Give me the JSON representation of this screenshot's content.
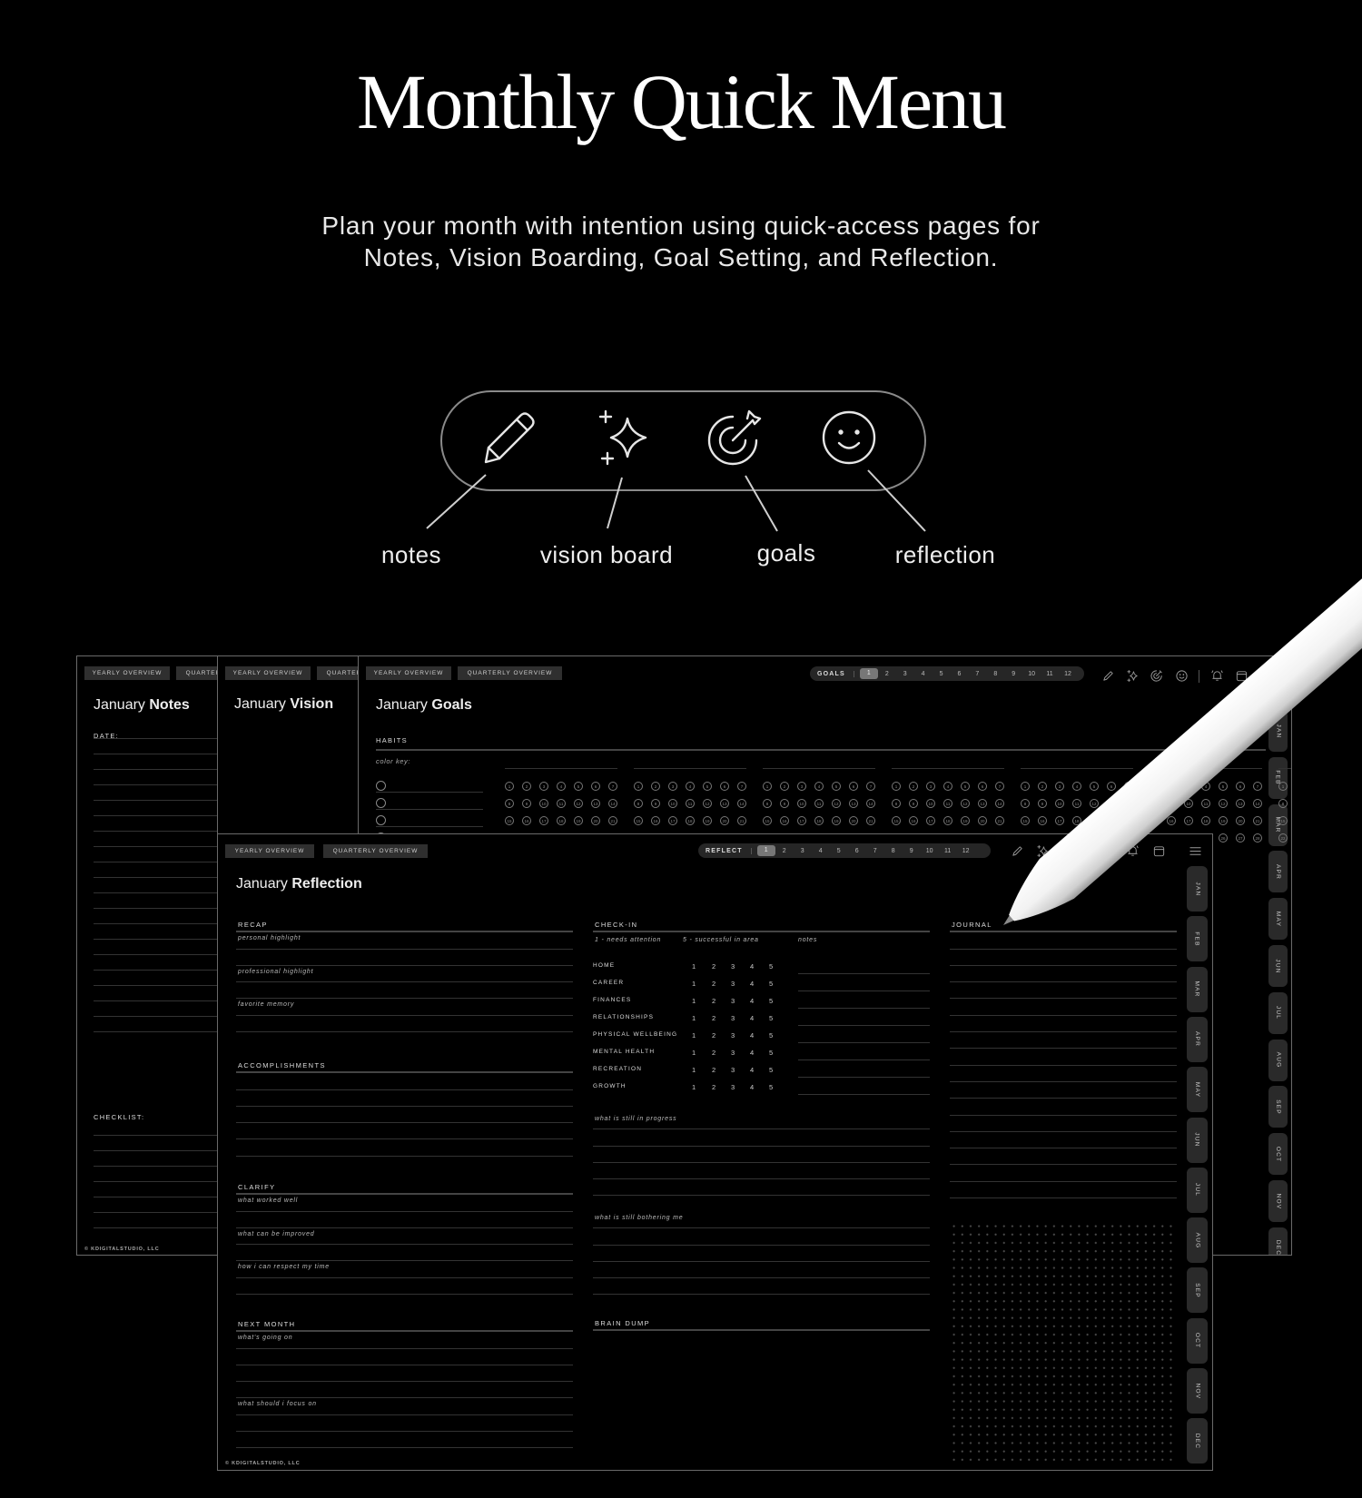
{
  "header": {
    "title": "Monthly Quick Menu",
    "subtitle_line1": "Plan your month with intention using quick-access pages for",
    "subtitle_line2": "Notes, Vision Boarding, Goal Setting, and Reflection."
  },
  "quick_menu": {
    "items": [
      {
        "icon": "pencil-icon",
        "label": "notes"
      },
      {
        "icon": "sparkle-icon",
        "label": "vision board"
      },
      {
        "icon": "target-icon",
        "label": "goals"
      },
      {
        "icon": "smiley-icon",
        "label": "reflection"
      }
    ]
  },
  "common": {
    "yearly_overview": "YEARLY OVERVIEW",
    "quarterly_overview": "QUARTERLY OVERVIEW",
    "footer": "© KDIGITALSTUDIO, LLC",
    "months": [
      "JAN",
      "FEB",
      "MAR",
      "APR",
      "MAY",
      "JUN",
      "JUL",
      "AUG",
      "SEP",
      "OCT",
      "NOV",
      "DEC"
    ],
    "month_numbers": [
      "1",
      "2",
      "3",
      "4",
      "5",
      "6",
      "7",
      "8",
      "9",
      "10",
      "11",
      "12"
    ],
    "active_month": "1",
    "toolbar_icons": [
      "pencil-icon",
      "sparkle-icon",
      "target-icon",
      "smiley-icon",
      "bell-icon",
      "calendar-icon",
      "menu-icon"
    ]
  },
  "notes_page": {
    "title_light": "January",
    "title_bold": "Notes",
    "date_label": "DATE:",
    "checklist_label": "CHECKLIST:"
  },
  "vision_page": {
    "title_light": "January",
    "title_bold": "Vision"
  },
  "goals_page": {
    "title_light": "January",
    "title_bold": "Goals",
    "nav_label": "GOALS",
    "habits_label": "HABITS",
    "color_key_label": "color key:",
    "days": [
      "1",
      "2",
      "3",
      "4",
      "5",
      "6",
      "7",
      "8",
      "9",
      "10",
      "11",
      "12",
      "13",
      "14",
      "15",
      "16",
      "17",
      "18",
      "19",
      "20",
      "21",
      "22",
      "23",
      "24",
      "25",
      "26",
      "27",
      "28"
    ]
  },
  "reflection_page": {
    "title_light": "January",
    "title_bold": "Reflection",
    "nav_label": "REFLECT",
    "recap": {
      "label": "RECAP",
      "rows": [
        "personal highlight",
        "",
        "professional highlight",
        "",
        "favorite memory",
        ""
      ]
    },
    "accomplishments": {
      "label": "ACCOMPLISHMENTS",
      "rows": [
        "",
        "",
        "",
        "",
        ""
      ]
    },
    "clarify": {
      "label": "CLARIFY",
      "rows": [
        "what worked well",
        "",
        "what can be improved",
        "",
        "how i can respect my time",
        ""
      ]
    },
    "next_month": {
      "label": "NEXT MONTH",
      "rows": [
        "what's going on",
        "",
        "",
        "",
        "what should i focus on",
        "",
        ""
      ]
    },
    "check_in": {
      "label": "CHECK-IN",
      "legend_low": "1 - needs attention",
      "legend_high": "5 - successful in area",
      "legend_notes": "notes",
      "scale": [
        "1",
        "2",
        "3",
        "4",
        "5"
      ],
      "categories": [
        "HOME",
        "CAREER",
        "FINANCES",
        "RELATIONSHIPS",
        "PHYSICAL WELLBEING",
        "MENTAL HEALTH",
        "RECREATION",
        "GROWTH"
      ]
    },
    "in_progress": {
      "rows": [
        "what is still in progress",
        "",
        "",
        "",
        ""
      ]
    },
    "bothering": {
      "rows": [
        "what is still bothering me",
        "",
        "",
        "",
        ""
      ]
    },
    "brain_dump": {
      "label": "BRAIN DUMP"
    },
    "journal": {
      "label": "JOURNAL"
    }
  }
}
